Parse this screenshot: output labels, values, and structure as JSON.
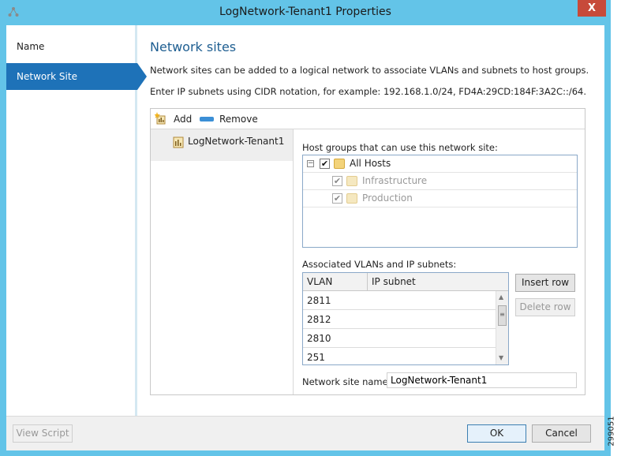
{
  "window": {
    "title": "LogNetwork-Tenant1 Properties",
    "close_glyph": "X",
    "app_icon": "network-app-icon"
  },
  "sidebar": {
    "items": [
      {
        "label": "Name",
        "active": false
      },
      {
        "label": "Network Site",
        "active": true
      }
    ]
  },
  "main": {
    "heading": "Network sites",
    "description_1": "Network sites can be added to a logical network to associate VLANs and subnets to host groups.",
    "description_2": "Enter IP subnets using CIDR notation, for example: 192.168.1.0/24, FD4A:29CD:184F:3A2C::/64.",
    "toolbar": {
      "add_label": "Add",
      "remove_label": "Remove"
    },
    "sites": [
      {
        "label": "LogNetwork-Tenant1"
      }
    ],
    "host_groups_label": "Host groups that can use this network site:",
    "host_groups": [
      {
        "label": "All Hosts",
        "checked": true,
        "dimmed": false,
        "expander": "−"
      },
      {
        "label": "Infrastructure",
        "checked": true,
        "dimmed": true
      },
      {
        "label": "Production",
        "checked": true,
        "dimmed": true
      }
    ],
    "vlans_label": "Associated VLANs and IP subnets:",
    "vlan_grid": {
      "columns": [
        "VLAN",
        "IP subnet"
      ],
      "rows": [
        {
          "vlan": "2811",
          "subnet": ""
        },
        {
          "vlan": "2812",
          "subnet": ""
        },
        {
          "vlan": "2810",
          "subnet": ""
        },
        {
          "vlan": "251",
          "subnet": ""
        }
      ]
    },
    "insert_row_label": "Insert row",
    "delete_row_label": "Delete row",
    "site_name_label": "Network site name:",
    "site_name_value": "LogNetwork-Tenant1"
  },
  "footer": {
    "view_script_label": "View Script",
    "ok_label": "OK",
    "cancel_label": "Cancel"
  },
  "figure_id": "299051",
  "colors": {
    "titlebar": "#63c4e8",
    "accent": "#1e72b8",
    "heading": "#1e5e91",
    "close": "#c74a3a"
  }
}
